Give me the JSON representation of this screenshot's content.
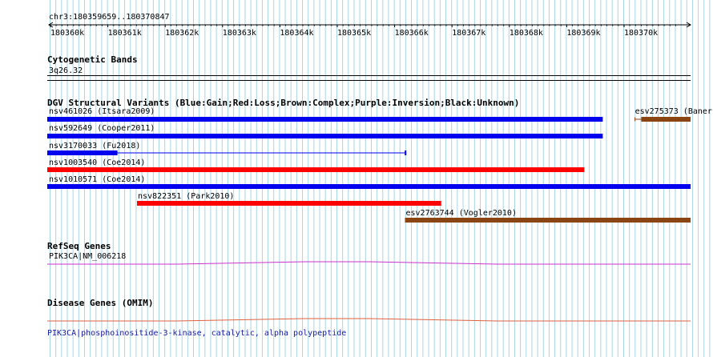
{
  "colors": {
    "grid": "#a7d6e4",
    "gain": "#0000ee",
    "loss": "#ff0000",
    "complex": "#8b4513",
    "refseq": "#cc33cc",
    "omim": "#e06040",
    "link": "#1a1aa6"
  },
  "ruler": {
    "position": "chr3:180359659..180370847",
    "start": 180359659,
    "end": 180370847,
    "ticks": [
      "180360k",
      "180361k",
      "180362k",
      "180363k",
      "180364k",
      "180365k",
      "180366k",
      "180367k",
      "180368k",
      "180369k",
      "180370k"
    ]
  },
  "tracks": {
    "cytoband": {
      "title": "Cytogenetic Bands",
      "band": "3q26.32"
    },
    "dgv": {
      "title": "DGV Structural Variants (Blue:Gain;Red:Loss;Brown:Complex;Purple:Inversion;Black:Unknown)",
      "variants": [
        {
          "label": "nsv461026 (Itsara2009)",
          "type": "gain",
          "start": 180359659,
          "end": 180369320
        },
        {
          "label": "esv275373 (Baner",
          "type": "complex",
          "start": 180369990,
          "end": 180370847,
          "whisker_start": 180369880
        },
        {
          "label": "nsv592649 (Cooper2011)",
          "type": "gain",
          "start": 180359659,
          "end": 180369320
        },
        {
          "label": "nsv3170033 (Fu2018)",
          "type": "gain",
          "start": 180359659,
          "end": 180360880,
          "line_end": 180365890
        },
        {
          "label": "nsv1003540 (Coe2014)",
          "type": "loss",
          "start": 180359659,
          "end": 180369000
        },
        {
          "label": "nsv1010571 (Coe2014)",
          "type": "gain",
          "start": 180359659,
          "end": 180370847
        },
        {
          "label": "nsv822351 (Park2010)",
          "type": "loss",
          "start": 180361220,
          "end": 180366510
        },
        {
          "label": "esv2763744 (Vogler2010)",
          "type": "complex",
          "start": 180365880,
          "end": 180370847
        }
      ]
    },
    "refseq": {
      "title": "RefSeq Genes",
      "gene": "PIK3CA|NM_006218"
    },
    "omim": {
      "title": "Disease Genes (OMIM)",
      "gene": "PIK3CA|phosphoinositide-3-kinase, catalytic, alpha polypeptide"
    }
  }
}
